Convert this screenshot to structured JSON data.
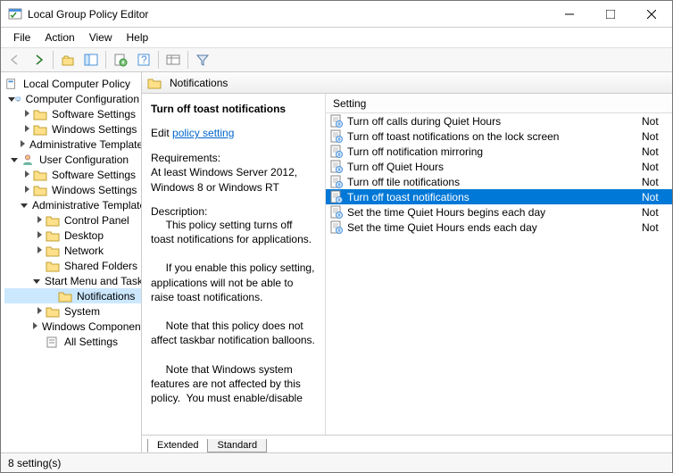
{
  "window": {
    "title": "Local Group Policy Editor"
  },
  "menubar": {
    "file": "File",
    "action": "Action",
    "view": "View",
    "help": "Help"
  },
  "tree": {
    "root": "Local Computer Policy",
    "computer_config": "Computer Configuration",
    "cc_software": "Software Settings",
    "cc_windows": "Windows Settings",
    "cc_admin": "Administrative Templates",
    "user_config": "User Configuration",
    "uc_software": "Software Settings",
    "uc_windows": "Windows Settings",
    "uc_admin": "Administrative Templates",
    "control_panel": "Control Panel",
    "desktop": "Desktop",
    "network": "Network",
    "shared_folders": "Shared Folders",
    "start_menu": "Start Menu and Taskbar",
    "notifications": "Notifications",
    "system": "System",
    "windows_comp": "Windows Components",
    "all_settings": "All Settings"
  },
  "header": {
    "path": "Notifications"
  },
  "details": {
    "title": "Turn off toast notifications",
    "edit_label": "Edit",
    "link": "policy setting",
    "req_label": "Requirements:",
    "req_text": "At least Windows Server 2012, Windows 8 or Windows RT",
    "desc_label": "Description:",
    "desc_text": "     This policy setting turns off toast notifications for applications.\n\n     If you enable this policy setting, applications will not be able to raise toast notifications.\n\n     Note that this policy does not affect taskbar notification balloons.\n\n     Note that Windows system features are not affected by this policy.  You must enable/disable"
  },
  "list": {
    "header": "Setting",
    "items": [
      {
        "label": "Turn off calls during Quiet Hours",
        "state": "Not"
      },
      {
        "label": "Turn off toast notifications on the lock screen",
        "state": "Not"
      },
      {
        "label": "Turn off notification mirroring",
        "state": "Not"
      },
      {
        "label": "Turn off Quiet Hours",
        "state": "Not"
      },
      {
        "label": "Turn off tile notifications",
        "state": "Not"
      },
      {
        "label": "Turn off toast notifications",
        "state": "Not"
      },
      {
        "label": "Set the time Quiet Hours begins each day",
        "state": "Not"
      },
      {
        "label": "Set the time Quiet Hours ends each day",
        "state": "Not"
      }
    ],
    "selected_index": 5
  },
  "tabs": {
    "extended": "Extended",
    "standard": "Standard"
  },
  "statusbar": {
    "text": "8 setting(s)"
  }
}
